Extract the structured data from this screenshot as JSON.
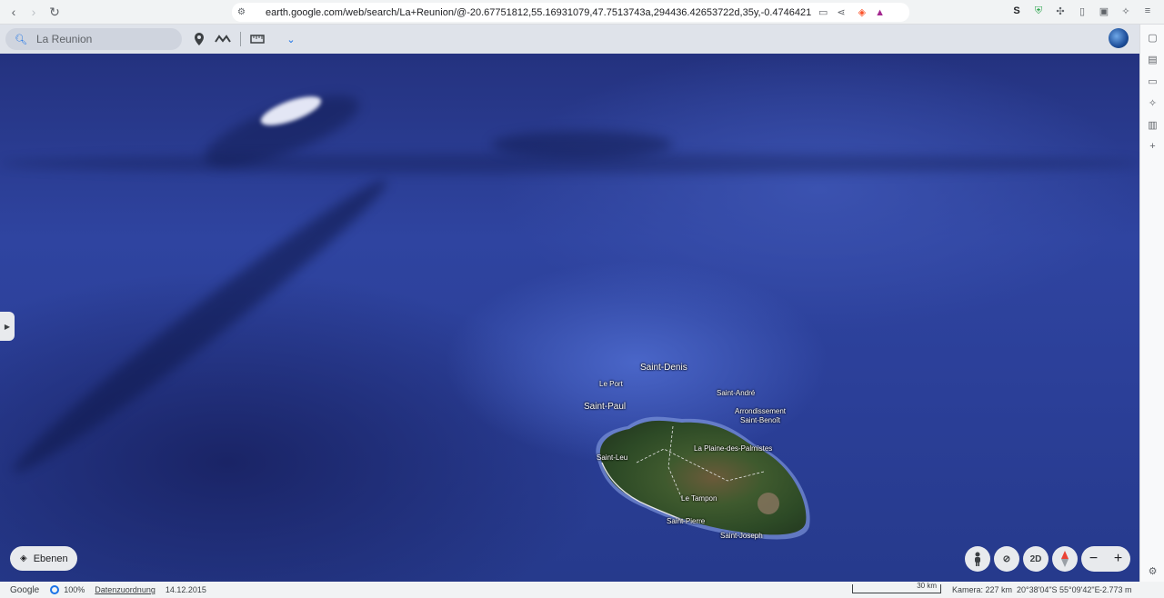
{
  "browser": {
    "url": "earth.google.com/web/search/La+Reunion/@-20.67751812,55.16931079,47.7513743a,294436.42653722d,35y,-0.47464217h,40.14616503..."
  },
  "toolbar": {
    "search_value": "La Reunion"
  },
  "map": {
    "places": [
      {
        "name": "Saint-Denis",
        "size": "big"
      },
      {
        "name": "Le Port",
        "size": "small"
      },
      {
        "name": "Saint-Paul",
        "size": "big"
      },
      {
        "name": "Saint-André",
        "size": "small"
      },
      {
        "name": "Arrondissement",
        "size": "small"
      },
      {
        "name": "Saint-Benoît",
        "size": "small"
      },
      {
        "name": "La Plaine-des-Palmistes",
        "size": "small"
      },
      {
        "name": "Saint-Leu",
        "size": "small"
      },
      {
        "name": "Le Tampon",
        "size": "small"
      },
      {
        "name": "Saint-Pierre",
        "size": "small"
      },
      {
        "name": "Saint-Joseph",
        "size": "small"
      }
    ]
  },
  "controls": {
    "layers_label": "Ebenen",
    "view_2d_label": "2D",
    "zoom_out": "−",
    "zoom_in": "+"
  },
  "status": {
    "brand": "Google",
    "progress": "100%",
    "attribution": "Datenzuordnung",
    "date": "14.12.2015",
    "scale": "30 km",
    "camera": "Kamera: 227 km",
    "coords": "20°38'04\"S 55°09'42\"E",
    "elevation": "-2.773 m"
  }
}
